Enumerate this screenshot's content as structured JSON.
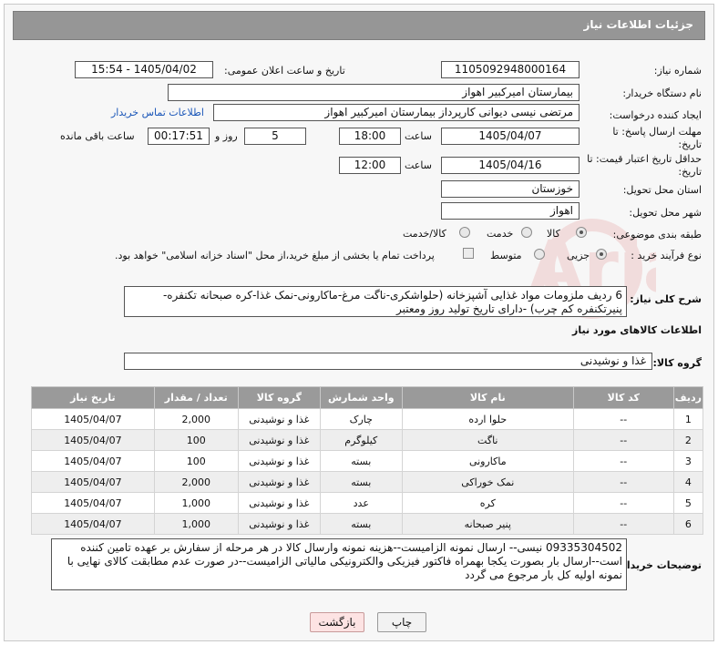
{
  "page": {
    "title": "جزئیات اطلاعات نیاز"
  },
  "form": {
    "need_number_label": "شماره نیاز:",
    "need_number": "1105092948000164",
    "announce_label": "تاریخ و ساعت اعلان عمومی:",
    "announce_value": "1405/04/02 - 15:54",
    "buyer_org_label": "نام دستگاه خریدار:",
    "buyer_org": "بیمارستان امیرکبیر اهواز",
    "requester_label": "ایجاد کننده درخواست:",
    "requester": "مرتضی نیسی دیوانی کارپرداز بیمارستان امیرکبیر اهواز",
    "contact_link": "اطلاعات تماس خریدار",
    "send_deadline_label": "مهلت ارسال پاسخ: تا تاریخ:",
    "send_date": "1405/04/07",
    "time_label": "ساعت",
    "send_time": "18:00",
    "days": "5",
    "days_label": "روز و",
    "remaining_time": "00:17:51",
    "remaining_label": "ساعت باقی مانده",
    "validity_label": "حداقل تاریخ اعتبار قیمت: تا تاریخ:",
    "validity_date": "1405/04/16",
    "validity_time": "12:00",
    "province_label": "استان محل تحویل:",
    "province": "خوزستان",
    "city_label": "شهر محل تحویل:",
    "city": "اهواز",
    "category_label": "طبقه بندی موضوعی:",
    "category_options": [
      "کالا",
      "خدمت",
      "کالا/خدمت"
    ],
    "process_label": "نوع فرآیند خرید :",
    "process_options": [
      "جزیی",
      "متوسط"
    ],
    "payment_note": "پرداخت تمام یا بخشی از مبلغ خرید،از محل \"اسناد خزانه اسلامی\" خواهد بود.",
    "summary_label": "شرح کلی نیاز:",
    "summary": "6 ردیف ملزومات مواد غذایی آشپزخانه (حلواشکری-ناگت مرغ-ماکارونی-نمک غذا-کره صبحانه تکنفره-پنیرتکنفره کم چرب) -دارای تاریخ تولید روز ومعتبر",
    "goods_info_title": "اطلاعات کالاهای مورد نیاز",
    "goods_group_label": "گروه کالا:",
    "goods_group": "غذا و نوشیدنی",
    "buyer_notes_label": "توضیحات خریدار:",
    "buyer_notes": "09335304502 نیسی-- ارسال نمونه الزامیست--هزینه نمونه وارسال کالا در هر مرحله از سفارش بر عهده تامین کننده است--ارسال بار بصورت یکجا بهمراه فاکتور فیزیکی والکترونیکی مالیاتی الزامیست--در صورت عدم مطابقت کالای نهایی با نمونه اولیه کل بار مرجوع می گردد"
  },
  "table": {
    "headers": [
      "ردیف",
      "کد کالا",
      "نام کالا",
      "واحد شمارش",
      "گروه کالا",
      "تعداد / مقدار",
      "تاریخ نیاز"
    ],
    "rows": [
      [
        "1",
        "--",
        "حلوا ارده",
        "چارک",
        "غذا و نوشیدنی",
        "2,000",
        "1405/04/07"
      ],
      [
        "2",
        "--",
        "ناگت",
        "کیلوگرم",
        "غذا و نوشیدنی",
        "100",
        "1405/04/07"
      ],
      [
        "3",
        "--",
        "ماکارونی",
        "بسته",
        "غذا و نوشیدنی",
        "100",
        "1405/04/07"
      ],
      [
        "4",
        "--",
        "نمک خوراکی",
        "بسته",
        "غذا و نوشیدنی",
        "2,000",
        "1405/04/07"
      ],
      [
        "5",
        "--",
        "کره",
        "عدد",
        "غذا و نوشیدنی",
        "1,000",
        "1405/04/07"
      ],
      [
        "6",
        "--",
        "پنیر صبحانه",
        "بسته",
        "غذا و نوشیدنی",
        "1,000",
        "1405/04/07"
      ]
    ]
  },
  "buttons": {
    "print": "چاپ",
    "back": "بازگشت"
  },
  "watermark": {
    "text": "AriaTender.net"
  }
}
